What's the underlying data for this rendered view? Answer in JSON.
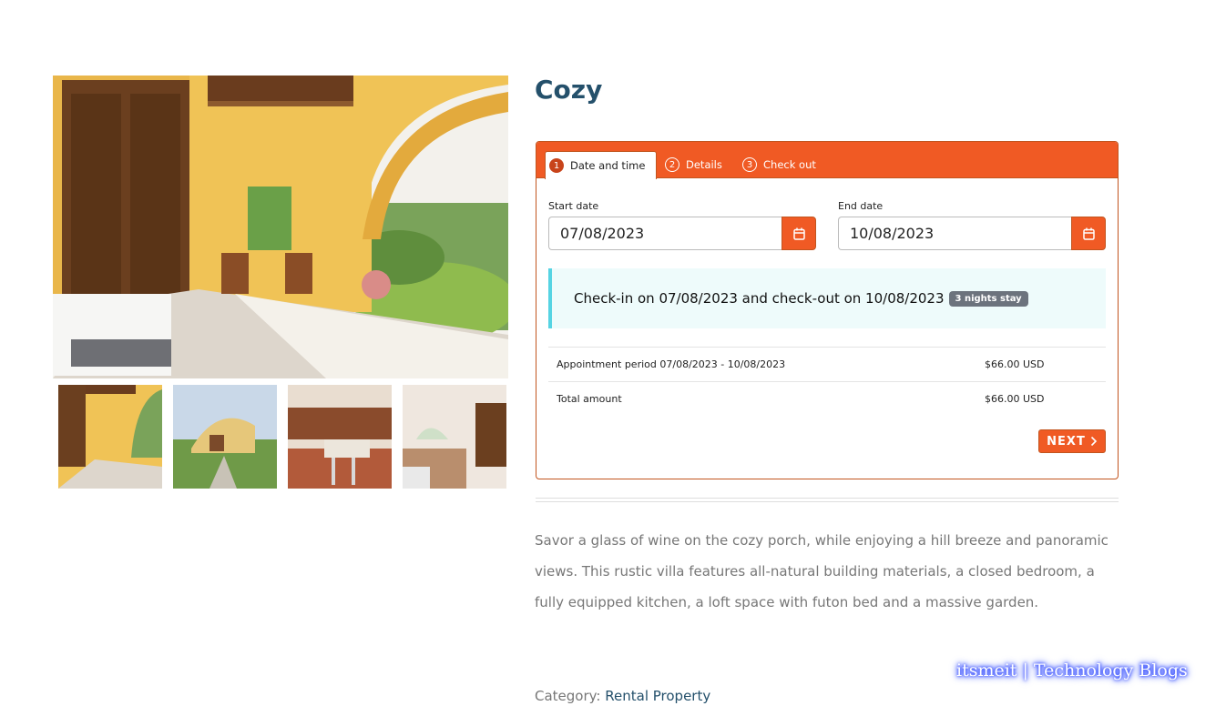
{
  "product": {
    "title": "Cozy",
    "description": "Savor a glass of wine on the cozy porch, while enjoying a hill breeze and panoramic views. This rustic villa features all-natural building materials, a closed bedroom, a fully equipped kitchen, a loft space with futon bed and a massive garden.",
    "category_label": "Category:",
    "category_link": "Rental Property"
  },
  "booking": {
    "tabs": [
      {
        "number": "1",
        "label": "Date and time",
        "active": true
      },
      {
        "number": "2",
        "label": "Details",
        "active": false
      },
      {
        "number": "3",
        "label": "Check out",
        "active": false
      }
    ],
    "start_date_label": "Start date",
    "start_date_value": "07/08/2023",
    "end_date_label": "End date",
    "end_date_value": "10/08/2023",
    "notice_text": "Check-in on 07/08/2023 and check-out on 10/08/2023",
    "nights_badge": "3 nights stay",
    "summary": [
      {
        "label": "Appointment period 07/08/2023 - 10/08/2023",
        "amount": "$66.00 USD"
      },
      {
        "label": "Total amount",
        "amount": "$66.00 USD"
      }
    ],
    "next_button": "NEXT"
  },
  "icons": {
    "calendar": "calendar-icon",
    "next": "chevron-right-icon"
  },
  "colors": {
    "accent": "#f05a24",
    "title": "#24506b",
    "notice_border": "#56d4e3",
    "badge": "#6c737d"
  },
  "watermark": "itsmeit | Technology Blogs"
}
